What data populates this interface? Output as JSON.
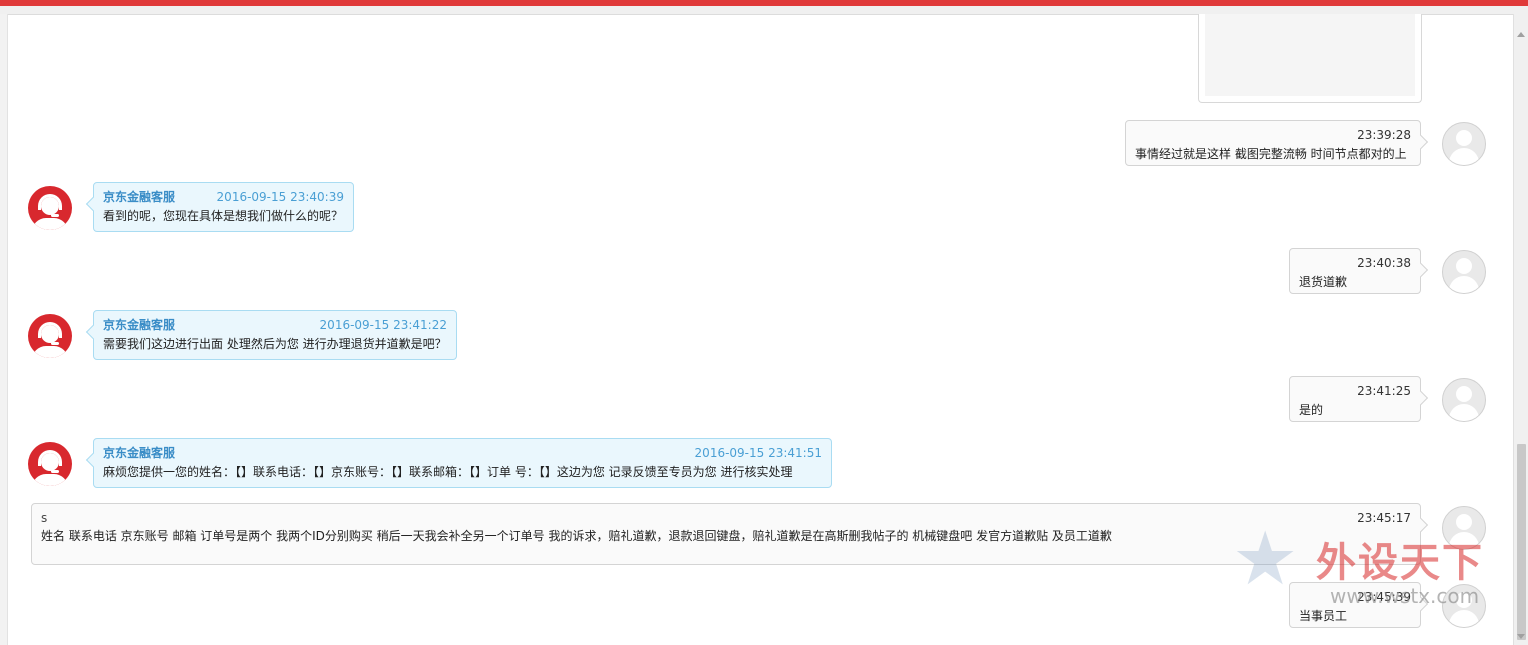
{
  "messages": [
    {
      "side": "user",
      "sender": "",
      "time": "23:39:28",
      "text": "事情经过就是这样  截图完整流畅  时间节点都对的上"
    },
    {
      "side": "agent",
      "sender": "京东金融客服",
      "time": "2016-09-15 23:40:39",
      "text": "看到的呢，您现在具体是想我们做什么的呢？"
    },
    {
      "side": "user",
      "sender": "",
      "time": "23:40:38",
      "text": "退货道歉"
    },
    {
      "side": "agent",
      "sender": "京东金融客服",
      "time": "2016-09-15 23:41:22",
      "text": "需要我们这边进行出面 处理然后为您 进行办理退货并道歉是吧？"
    },
    {
      "side": "user",
      "sender": "",
      "time": "23:41:25",
      "text": "是的"
    },
    {
      "side": "agent",
      "sender": "京东金融客服",
      "time": "2016-09-15 23:41:51",
      "text": "麻烦您提供一您的姓名：【】联系电话：【】京东账号：【】联系邮箱：【】订单 号：【】这边为您 记录反馈至专员为您 进行核实处理"
    },
    {
      "side": "user",
      "sender": "s",
      "time": "23:45:17",
      "text": "姓名                 联系电话                            京东账号                    邮箱                              订单号是两个 我两个ID分别购买                                    稍后一天我会补全另一个订单号    我的诉求，赔礼道歉，退款退回键盘，赔礼道歉是在高斯删我帖子的 机械键盘吧 发官方道歉贴 及员工道歉"
    },
    {
      "side": "user",
      "sender": "",
      "time": "23:45:39",
      "text": "当事员工"
    }
  ],
  "watermark": {
    "brand": "外设天下",
    "url": "www.wstx.com"
  },
  "colors": {
    "top_bar": "#e03a3a",
    "agent_name": "#3a8dc7",
    "agent_bubble": "#eaf7fd",
    "user_bubble": "#fafafa"
  }
}
